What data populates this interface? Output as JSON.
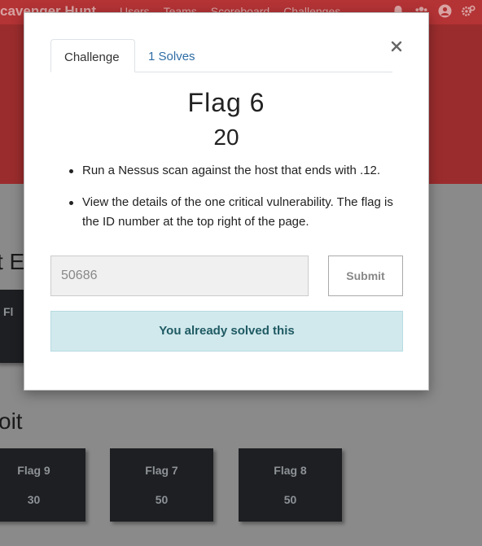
{
  "navbar": {
    "brand": "cavenger Hunt",
    "links": [
      "Users",
      "Teams",
      "Scoreboard",
      "Challenges"
    ],
    "icons": [
      "bell-icon",
      "users-icon",
      "user-circle-icon",
      "cogs-icon"
    ]
  },
  "sections": [
    {
      "title": "t Ex"
    },
    {
      "title": "oit"
    }
  ],
  "background_cards": [
    {
      "name": "Fl",
      "value": ""
    },
    {
      "name": "Flag 9",
      "value": "30"
    },
    {
      "name": "Flag 7",
      "value": "50"
    },
    {
      "name": "Flag 8",
      "value": "50"
    }
  ],
  "modal": {
    "tabs": [
      "Challenge",
      "1 Solves"
    ],
    "close_label": "×",
    "title": "Flag 6",
    "value": "20",
    "description": [
      "Run a Nessus scan against the host that ends with .12.",
      "View the details of the one critical vulnerability. The flag is the ID number at the top right of the page."
    ],
    "input_value": "50686",
    "submit_label": "Submit",
    "notice": "You already solved this"
  },
  "colors": {
    "navbar": "#b43335",
    "jumbotron": "#9b2c2d",
    "overlay": "#8a8a8a",
    "card": "#1d1f22",
    "notice_bg": "#d1e9ed",
    "notice_text": "#1f5a63",
    "tab_link": "#2e6ca4"
  }
}
